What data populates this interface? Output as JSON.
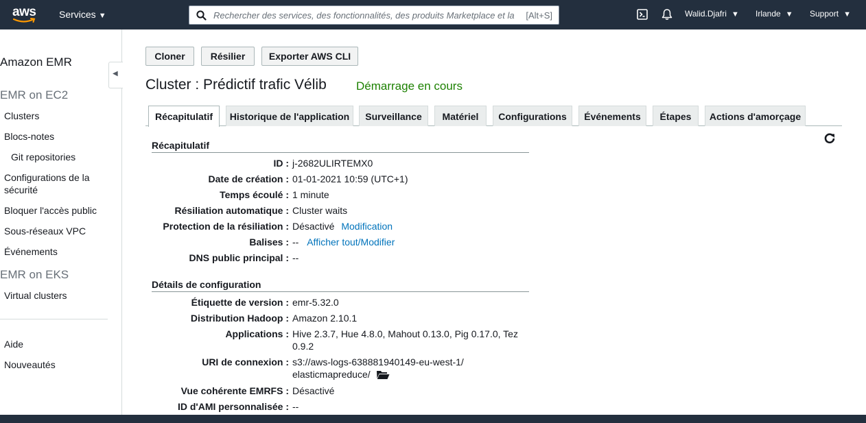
{
  "nav": {
    "logo_text": "aws",
    "services_label": "Services",
    "search_placeholder": "Rechercher des services, des fonctionnalités, des produits Marketplace et la documentation",
    "search_shortcut": "[Alt+S]",
    "user": "Walid.Djafri",
    "region": "Irlande",
    "support": "Support",
    "icons": [
      "cloudshell-icon",
      "bell-icon",
      "search-icon",
      "caret-down-icon"
    ]
  },
  "sidebar": {
    "title": "Amazon EMR",
    "section1": "EMR on EC2",
    "items1": [
      "Clusters",
      "Blocs-notes",
      "Git repositories",
      "Configurations de la sécurité",
      "Bloquer l'accès public",
      "Sous-réseaux VPC",
      "Événements"
    ],
    "section2": "EMR on EKS",
    "items2": [
      "Virtual clusters"
    ],
    "items3": [
      "Aide",
      "Nouveautés"
    ]
  },
  "actions": {
    "clone": "Cloner",
    "terminate": "Résilier",
    "export": "Exporter AWS CLI"
  },
  "cluster": {
    "title": "Cluster : Prédictif trafic Vélib",
    "status": "Démarrage en cours",
    "status_color": "#1d8102"
  },
  "tabs": [
    "Récapitulatif",
    "Historique de l'application",
    "Surveillance",
    "Matériel",
    "Configurations",
    "Événements",
    "Étapes",
    "Actions d'amorçage"
  ],
  "summary": {
    "heading": "Récapitulatif",
    "rows": [
      {
        "label": "ID :",
        "value": "j-2682ULIRTEMX0"
      },
      {
        "label": "Date de création :",
        "value": "01-01-2021 10:59 (UTC+1)"
      },
      {
        "label": "Temps écoulé :",
        "value": "1 minute"
      },
      {
        "label": "Résiliation automatique :",
        "value": "Cluster waits"
      },
      {
        "label": "Protection de la résiliation :",
        "value": "Désactivé",
        "link": "Modification"
      },
      {
        "label": "Balises :",
        "value": "--",
        "link": "Afficher tout/Modifier"
      },
      {
        "label": "DNS public principal :",
        "value": "--"
      }
    ]
  },
  "config": {
    "heading": "Détails de configuration",
    "rows": [
      {
        "label": "Étiquette de version :",
        "value": "emr-5.32.0"
      },
      {
        "label": "Distribution Hadoop :",
        "value": "Amazon 2.10.1"
      },
      {
        "label": "Applications :",
        "value": "Hive 2.3.7, Hue 4.8.0, Mahout 0.13.0, Pig 0.17.0, Tez 0.9.2"
      },
      {
        "label": "URI de connexion :",
        "value": "s3://aws-logs-638881940149-eu-west-1/elasticmapreduce/"
      },
      {
        "label": "Vue cohérente EMRFS :",
        "value": "Désactivé"
      },
      {
        "label": "ID d'AMI personnalisée :",
        "value": "--"
      }
    ]
  }
}
